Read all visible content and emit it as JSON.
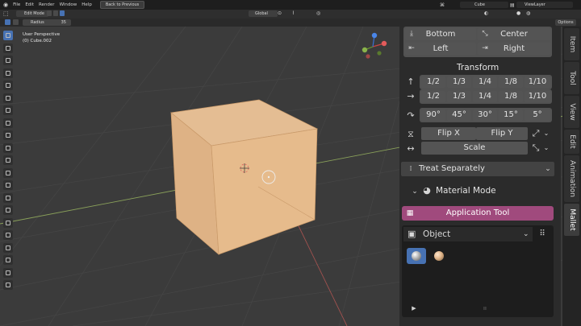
{
  "topbar": {
    "menus": [
      "File",
      "Edit",
      "Render",
      "Window",
      "Help"
    ],
    "back_label": "Back to Previous",
    "scene": "Cube",
    "view_layer": "ViewLayer"
  },
  "header": {
    "mode": "Edit Mode",
    "orientation": "Global",
    "radius_label": "Radius",
    "radius_value": "35",
    "options_label": "Options"
  },
  "viewport": {
    "perspective": "User Perspective",
    "object": "(0) Cube.002"
  },
  "panel": {
    "align": {
      "bottom": "Bottom",
      "center": "Center",
      "left": "Left",
      "right": "Right"
    },
    "transform": {
      "title": "Transform",
      "row1": [
        "1/2",
        "1/3",
        "1/4",
        "1/8",
        "1/10"
      ],
      "row2": [
        "1/2",
        "1/3",
        "1/4",
        "1/8",
        "1/10"
      ],
      "angles": [
        "90°",
        "45°",
        "30°",
        "15°",
        "5°"
      ],
      "flip_x": "Flip X",
      "flip_y": "Flip Y",
      "scale": "Scale"
    },
    "treat": "Treat Separately",
    "material_mode": "Material Mode",
    "application_tool": "Application Tool",
    "object_select": "Object"
  },
  "tabs": [
    "Item",
    "Tool",
    "View",
    "Edit",
    "Animation",
    "Mallet"
  ],
  "colors": {
    "accent_blue": "#4772b3",
    "application_tool": "#a04a7d",
    "cube": "#e0b58a"
  }
}
